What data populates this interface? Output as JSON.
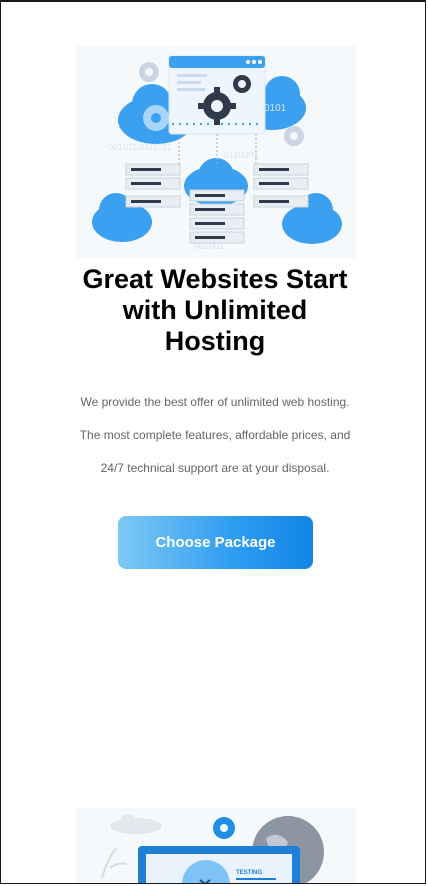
{
  "hero": {
    "title_line1": "Great Websites Start",
    "title_line2": "with Unlimited",
    "title_line3": "Hosting",
    "description_lines": [
      "We provide the best offer of unlimited web hosting.",
      "The most complete features, affordable prices, and",
      "24/7 technical support are at your disposal."
    ],
    "cta_label": "Choose Package",
    "illustration": {
      "binary_right": "0101",
      "binary_left": "0010110001011",
      "binary_mid": "0110001",
      "binary_bottom": "001001"
    }
  },
  "second_illustration": {
    "screen_label": "TESTING"
  },
  "colors": {
    "accent_blue": "#2d9cf0",
    "light_blue": "#7ec9f5",
    "cloud_blue": "#3aa0ef",
    "dark_gear": "#2f3a4a",
    "text_gray": "#666666"
  }
}
